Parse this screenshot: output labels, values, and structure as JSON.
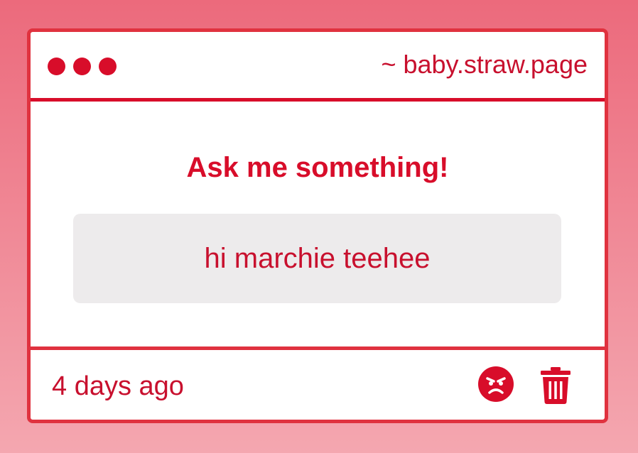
{
  "window": {
    "url": "~ baby.straw.page",
    "accent_color": "#d80d2a"
  },
  "main": {
    "prompt": "Ask me something!",
    "question": "hi marchie teehee"
  },
  "footer": {
    "time": "4 days ago",
    "icons": [
      "angry-face-icon",
      "trash-icon"
    ]
  }
}
